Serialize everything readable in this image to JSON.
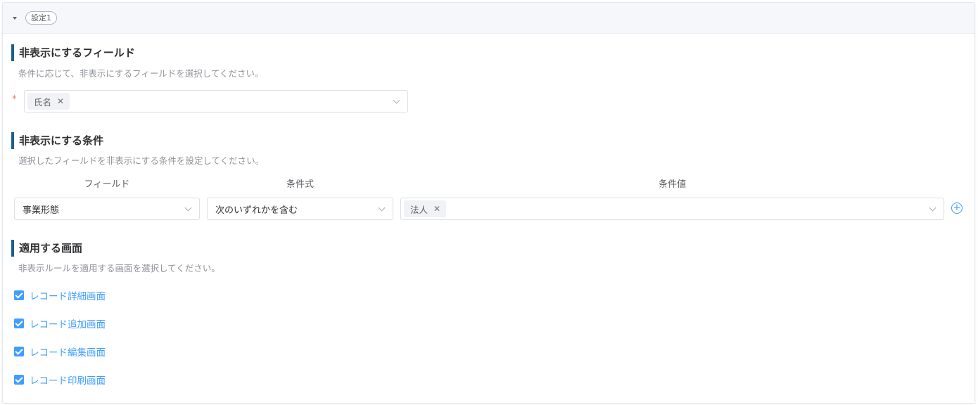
{
  "header": {
    "tag": "設定1"
  },
  "hidden_fields": {
    "title": "非表示にするフィールド",
    "description": "条件に応じて、非表示にするフィールドを選択してください。",
    "required_mark": "*",
    "selected": [
      "氏名"
    ]
  },
  "condition": {
    "title": "非表示にする条件",
    "description": "選択したフィールドを非表示にする条件を設定してください。",
    "columns": {
      "field": "フィールド",
      "operator": "条件式",
      "value": "条件値"
    },
    "field_value": "事業形態",
    "operator_value": "次のいずれかを含む",
    "values": [
      "法人"
    ]
  },
  "screens": {
    "title": "適用する画面",
    "description": "非表示ルールを適用する画面を選択してください。",
    "options": [
      {
        "label": "レコード詳細画面",
        "checked": true
      },
      {
        "label": "レコード追加画面",
        "checked": true
      },
      {
        "label": "レコード編集画面",
        "checked": true
      },
      {
        "label": "レコード印刷画面",
        "checked": true
      }
    ]
  },
  "icons": {
    "collapse": "caret-down-icon",
    "chip_remove": "close-icon",
    "dropdown": "chevron-down-icon",
    "add": "plus-circle-icon",
    "checkbox": "checkbox-checked-icon"
  },
  "colors": {
    "accent": "#409eff",
    "section_bar": "#1b5f8e",
    "required": "#f56c6c"
  }
}
